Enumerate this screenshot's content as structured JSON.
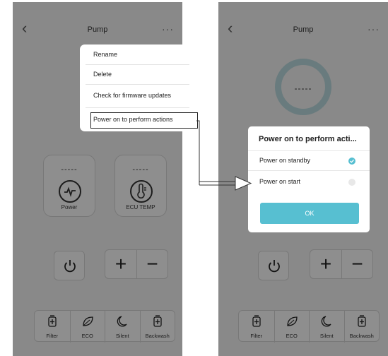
{
  "app": {
    "title": "Pump",
    "back_glyph": "‹",
    "more_glyph": "···"
  },
  "left_screen": {
    "cards": [
      {
        "value": "-----",
        "label": "Power",
        "icon": "pulse-icon"
      },
      {
        "value": "-----",
        "label": "ECU TEMP",
        "icon": "thermometer-icon"
      }
    ],
    "menu": {
      "items": [
        {
          "label": "Rename"
        },
        {
          "label": "Delete"
        },
        {
          "label": "Check for firmware updates"
        },
        {
          "label": "Power on to perform actions",
          "highlighted": true
        }
      ]
    }
  },
  "right_screen": {
    "ring_value": "-----",
    "dialog": {
      "title": "Power on to perform acti...",
      "options": [
        {
          "label": "Power on standby",
          "selected": true
        },
        {
          "label": "Power on start",
          "selected": false
        }
      ],
      "ok_label": "OK"
    }
  },
  "controls": {
    "plus_glyph": "+",
    "minus_glyph": "−"
  },
  "modes": [
    {
      "label": "Filter",
      "icon": "filter-icon"
    },
    {
      "label": "ECO",
      "icon": "leaf-icon"
    },
    {
      "label": "Silent",
      "icon": "moon-icon"
    },
    {
      "label": "Backwash",
      "icon": "backwash-icon"
    }
  ],
  "colors": {
    "accent": "#57bfd1",
    "ring": "#b6d5d9",
    "selected_check": "#57bfd1",
    "unselected_radio": "#e8e8e8"
  }
}
